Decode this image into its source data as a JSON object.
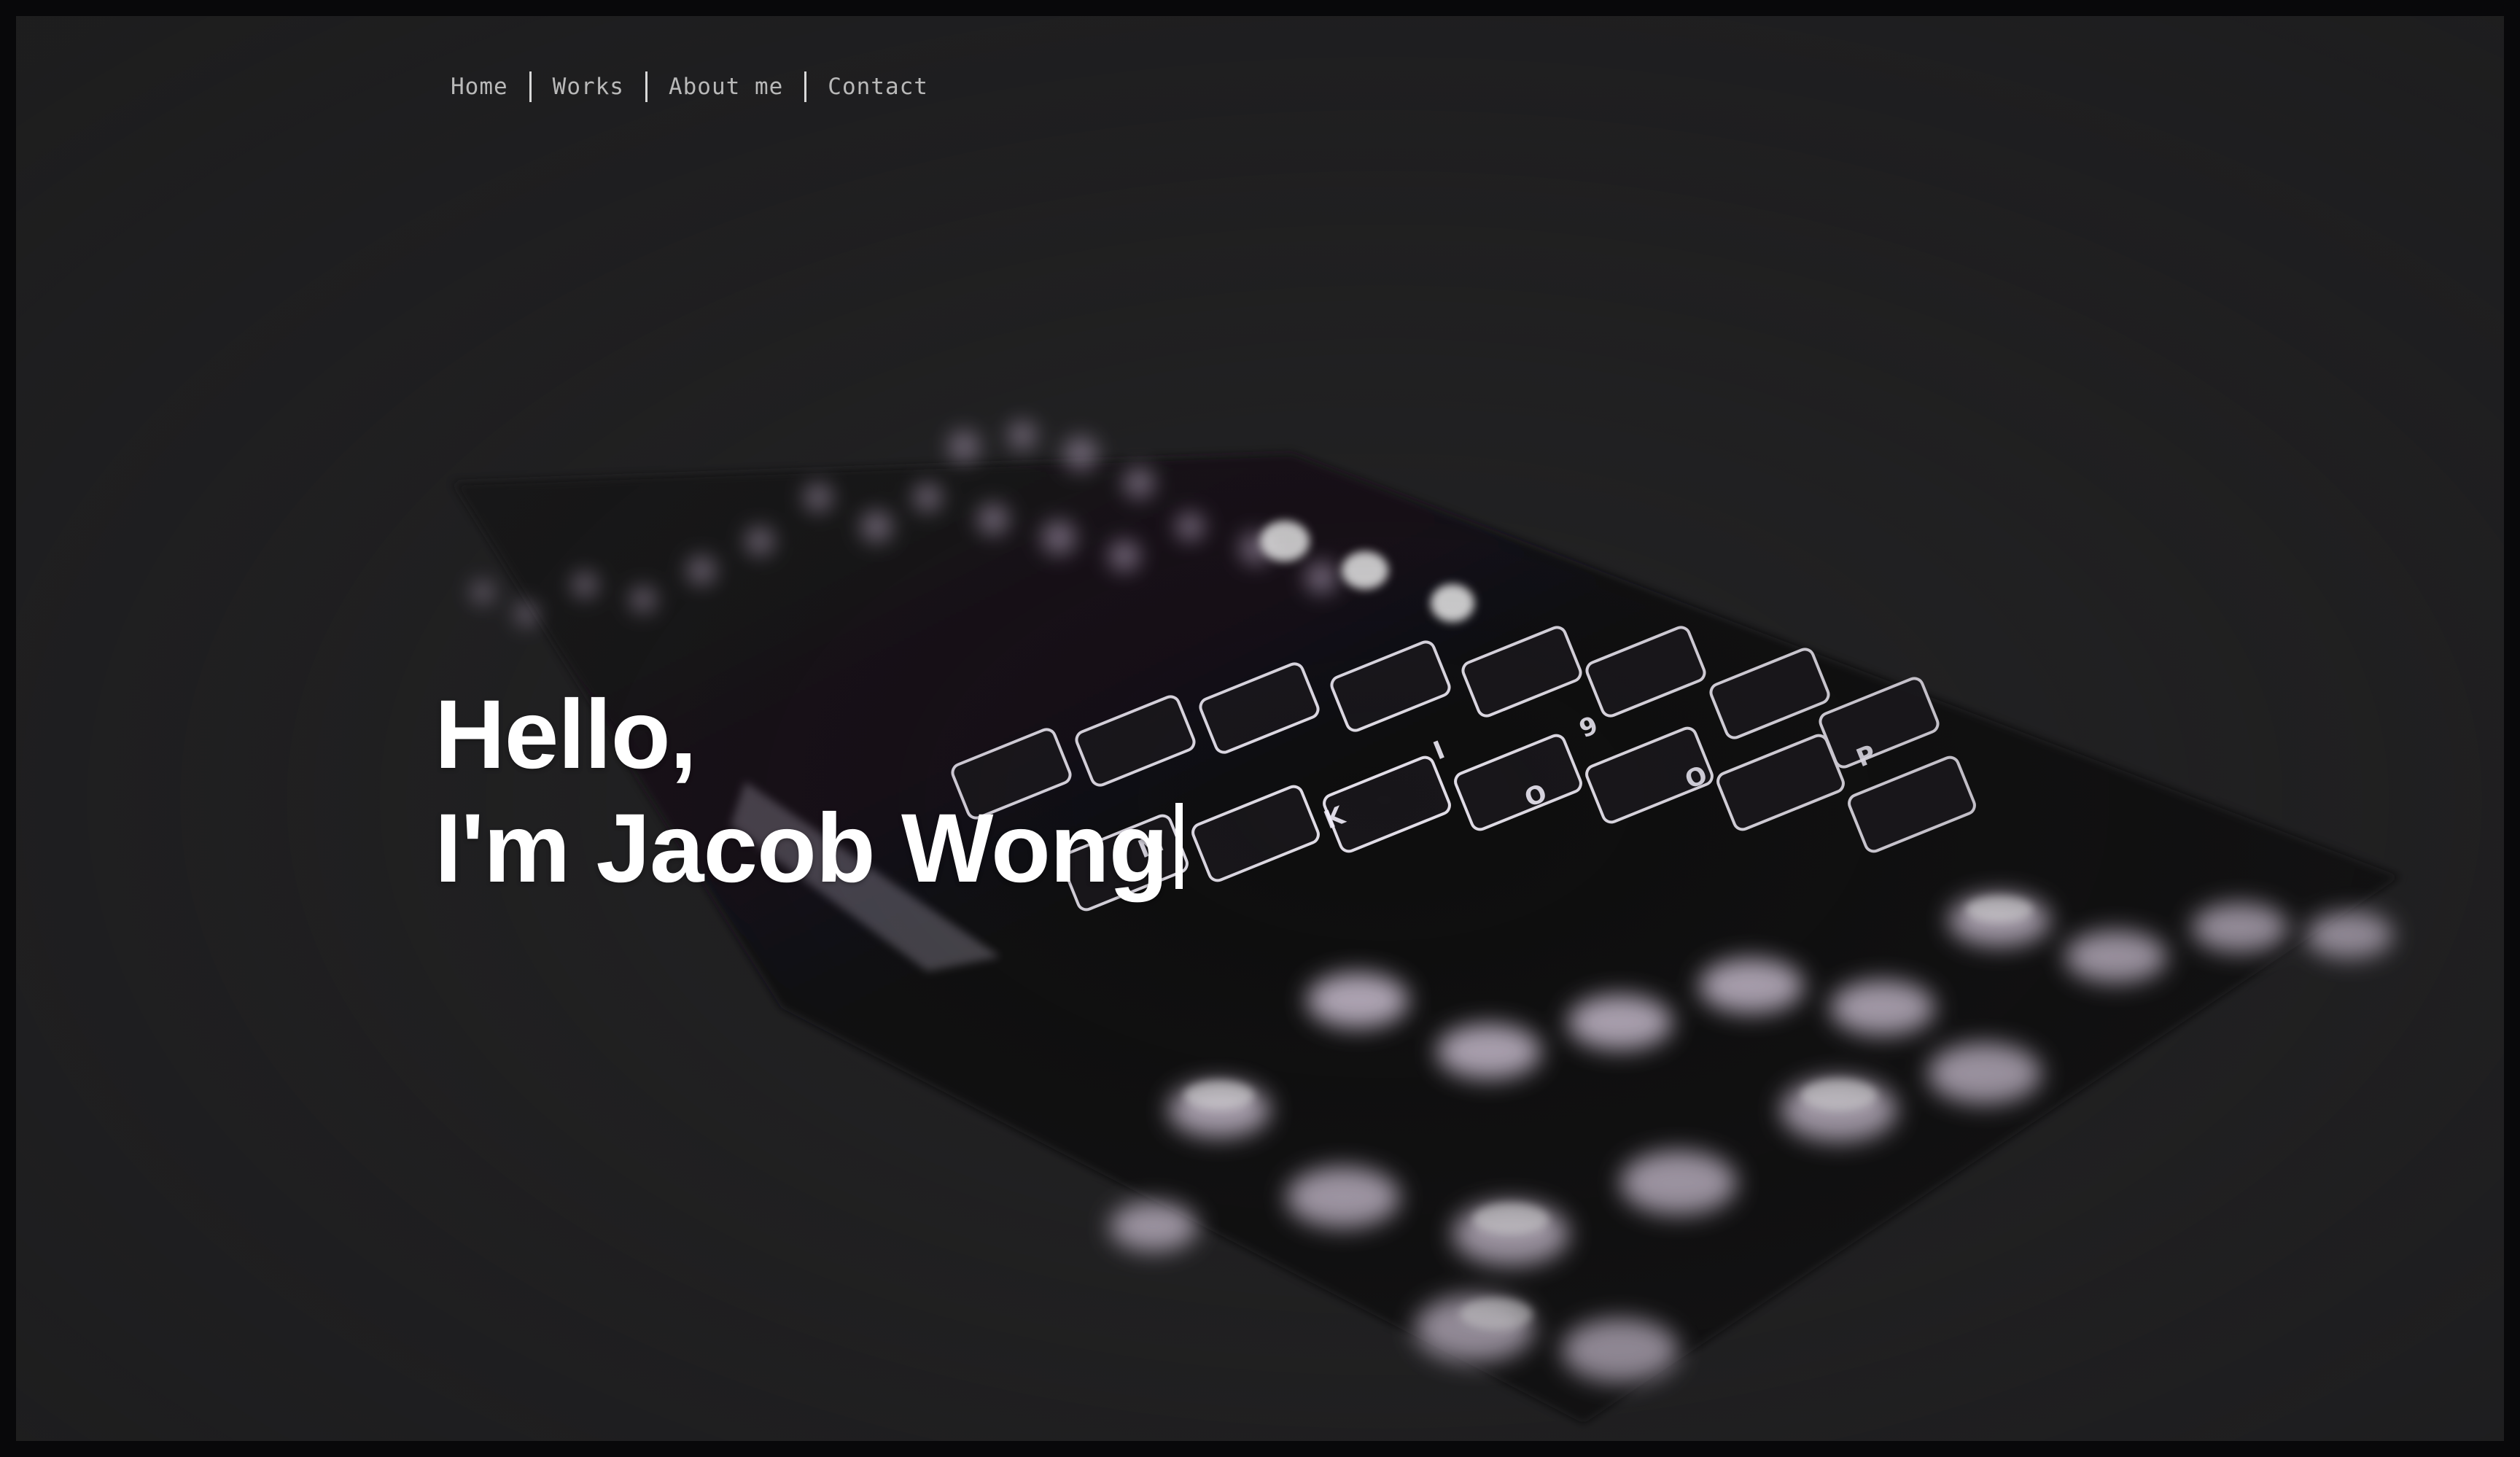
{
  "nav": {
    "items": [
      {
        "label": "Home"
      },
      {
        "label": "Works"
      },
      {
        "label": "About me"
      },
      {
        "label": "Contact"
      }
    ]
  },
  "hero": {
    "greeting": "Hello,",
    "intro": "I'm Jacob Wong",
    "background_image": "backlit-keyboard-photo"
  },
  "colors": {
    "background": "#222223",
    "nav_text": "#b9b9b9",
    "headline_text": "#ffffff",
    "key_glow": "#e9dcf0"
  }
}
